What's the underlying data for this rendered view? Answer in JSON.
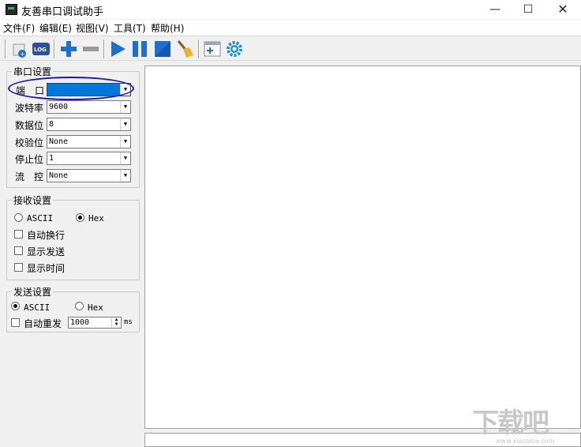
{
  "window": {
    "title": "友善串口调试助手",
    "minimize": "—",
    "maximize": "☐",
    "close": "✕"
  },
  "menu": [
    "文件(F)",
    "编辑(E)",
    "视图(V)",
    "工具(T)",
    "帮助(H)"
  ],
  "toolbar": {
    "icons": [
      "new-port-icon",
      "log-icon",
      "add-icon",
      "remove-icon",
      "run-icon",
      "pause-icon",
      "stop-icon",
      "clear-broom-icon",
      "add-window-icon",
      "settings-gear-icon"
    ],
    "log_text": "LOG"
  },
  "serial_settings": {
    "title": "串口设置",
    "port_label": "端　口",
    "port_value": "",
    "baud_label": "波特率",
    "baud_value": "9600",
    "databits_label": "数据位",
    "databits_value": "8",
    "parity_label": "校验位",
    "parity_value": "None",
    "stopbits_label": "停止位",
    "stopbits_value": "1",
    "flow_label": "流　控",
    "flow_value": "None"
  },
  "receive_settings": {
    "title": "接收设置",
    "ascii_label": "ASCII",
    "hex_label": "Hex",
    "mode": "Hex",
    "auto_wrap_label": "自动换行",
    "show_send_label": "显示发送",
    "show_time_label": "显示时间"
  },
  "send_settings": {
    "title": "发送设置",
    "ascii_label": "ASCII",
    "hex_label": "Hex",
    "mode": "ASCII",
    "auto_resend_label": "自动重发",
    "interval_value": "1000",
    "interval_unit": "ms"
  },
  "watermark": {
    "text": "下载吧",
    "sub": "www.xiazaiba.com"
  },
  "colors": {
    "accent": "#0078d7",
    "highlight_oval": "#1a1aa8",
    "toolbar_blue": "#1e6fd0"
  }
}
